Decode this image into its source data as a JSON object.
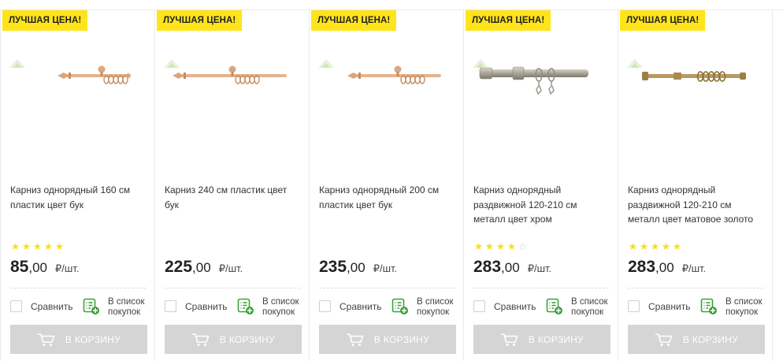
{
  "colors": {
    "badge": "#ffe41b",
    "star": "#f4e11b",
    "button": "#d5d5d5",
    "wishlist": "#3aa23a"
  },
  "products": [
    {
      "badge": "ЛУЧШАЯ ЦЕНА!",
      "image_icon": "curtain-rod-beech-icon",
      "title": "Карниз однорядный 160 см пластик цвет бук",
      "rating": 5,
      "price_int": "85",
      "price_dec": ",00",
      "unit": "₽/шт.",
      "compare_label": "Сравнить",
      "wishlist_line1": "В список",
      "wishlist_line2": "покупок",
      "cart_label": "В КОРЗИНУ"
    },
    {
      "badge": "ЛУЧШАЯ ЦЕНА!",
      "image_icon": "curtain-rod-beech-icon",
      "title": "Карниз 240 см пластик цвет бук",
      "rating": 0,
      "price_int": "225",
      "price_dec": ",00",
      "unit": "₽/шт.",
      "compare_label": "Сравнить",
      "wishlist_line1": "В список",
      "wishlist_line2": "покупок",
      "cart_label": "В КОРЗИНУ"
    },
    {
      "badge": "ЛУЧШАЯ ЦЕНА!",
      "image_icon": "curtain-rod-beech-icon",
      "title": "Карниз однорядный 200 см пластик цвет бук",
      "rating": 0,
      "price_int": "235",
      "price_dec": ",00",
      "unit": "₽/шт.",
      "compare_label": "Сравнить",
      "wishlist_line1": "В список",
      "wishlist_line2": "покупок",
      "cart_label": "В КОРЗИНУ"
    },
    {
      "badge": "ЛУЧШАЯ ЦЕНА!",
      "image_icon": "curtain-rod-chrome-icon",
      "title": "Карниз однорядный раздвижной 120-210 см металл цвет хром",
      "rating": 4,
      "price_int": "283",
      "price_dec": ",00",
      "unit": "₽/шт.",
      "compare_label": "Сравнить",
      "wishlist_line1": "В список",
      "wishlist_line2": "покупок",
      "cart_label": "В КОРЗИНУ"
    },
    {
      "badge": "ЛУЧШАЯ ЦЕНА!",
      "image_icon": "curtain-rod-gold-icon",
      "title": "Карниз однорядный раздвижной 120-210 см металл цвет матовое золото",
      "rating": 5,
      "price_int": "283",
      "price_dec": ",00",
      "unit": "₽/шт.",
      "compare_label": "Сравнить",
      "wishlist_line1": "В список",
      "wishlist_line2": "покупок",
      "cart_label": "В КОРЗИНУ"
    }
  ]
}
